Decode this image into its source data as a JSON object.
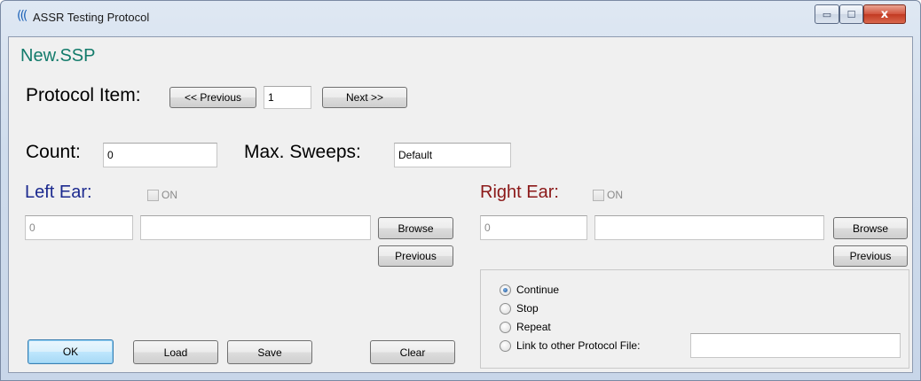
{
  "window": {
    "title": "ASSR Testing Protocol",
    "icon_glyph": "(((",
    "minimize_glyph": "▭",
    "maximize_glyph": "☐",
    "close_glyph": "x"
  },
  "file_name": "New.SSP",
  "protocol": {
    "label": "Protocol Item:",
    "previous_label": "<< Previous",
    "item_value": "1",
    "next_label": "Next >>"
  },
  "count": {
    "label": "Count:",
    "value": "0"
  },
  "max_sweeps": {
    "label": "Max. Sweeps:",
    "value": "Default"
  },
  "left_ear": {
    "label": "Left Ear:",
    "on_label": "ON",
    "on_checked": false,
    "number_value": "0",
    "path_value": "",
    "browse_label": "Browse",
    "previous_label": "Previous"
  },
  "right_ear": {
    "label": "Right Ear:",
    "on_label": "ON",
    "on_checked": false,
    "number_value": "0",
    "path_value": "",
    "browse_label": "Browse",
    "previous_label": "Previous"
  },
  "after_options": {
    "selected": "Continue",
    "options": [
      "Continue",
      "Stop",
      "Repeat",
      "Link to other Protocol File:"
    ],
    "link_file_value": ""
  },
  "buttons": {
    "ok": "OK",
    "load": "Load",
    "save": "Save",
    "clear": "Clear"
  },
  "colors": {
    "file_name": "#137b6b",
    "left_ear": "#1c2a8f",
    "right_ear": "#8b1818"
  }
}
